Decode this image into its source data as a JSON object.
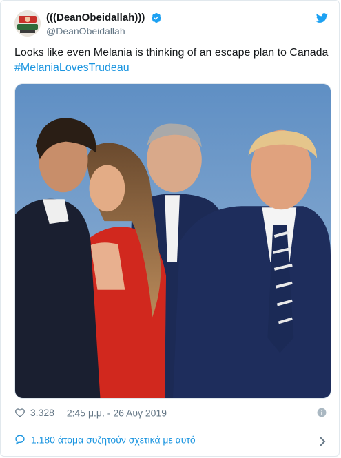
{
  "tweet": {
    "display_name": "(((DeanObeidallah)))",
    "handle": "@DeanObeidallah",
    "text": "Looks like even Melania is thinking of an escape plan to Canada",
    "hashtag": "#MelaniaLovesTrudeau",
    "likes": "3.328",
    "timestamp": "2:45 μ.μ. - 26 Αυγ 2019",
    "conversation": "1.180 άτομα συζητούν σχετικά με αυτό"
  },
  "icons": {
    "verified": "verified-badge-icon",
    "twitter": "twitter-bird-icon",
    "like": "heart-icon",
    "info": "info-icon",
    "reply": "speech-bubble-icon",
    "chevron": "chevron-right-icon"
  },
  "colors": {
    "accent": "#1b95e0",
    "text_primary": "#14171a",
    "text_secondary": "#657786",
    "border": "#e1e8ed"
  }
}
